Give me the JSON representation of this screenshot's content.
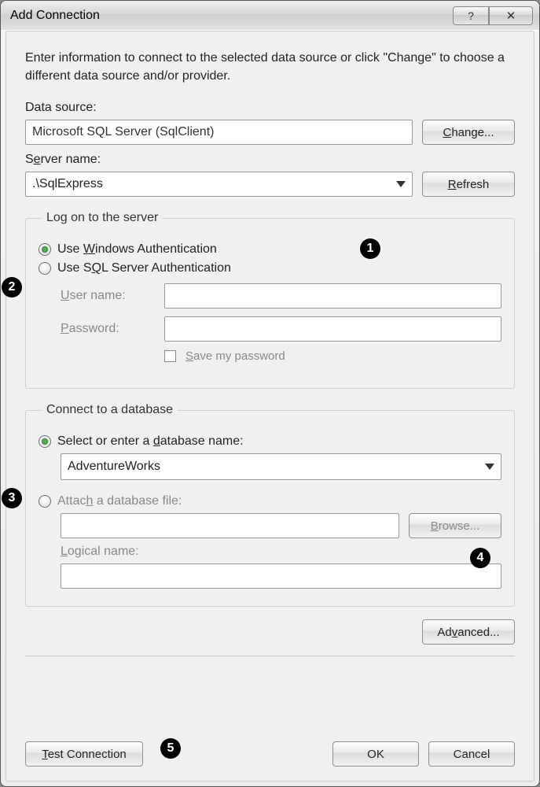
{
  "window": {
    "title": "Add Connection"
  },
  "instructions": "Enter information to connect to the selected data source or click \"Change\" to choose a different data source and/or provider.",
  "dataSource": {
    "label": "Data source:",
    "value": "Microsoft SQL Server (SqlClient)",
    "changeBtn": "Change..."
  },
  "serverName": {
    "label": "Server name:",
    "value": ".\\SqlExpress",
    "refreshBtn": "Refresh"
  },
  "logon": {
    "legend": "Log on to the server",
    "radioWindows": "Use Windows Authentication",
    "radioSql": "Use SQL Server Authentication",
    "userLabel": "User name:",
    "passLabel": "Password:",
    "saveCheck": "Save my password"
  },
  "database": {
    "legend": "Connect to a database",
    "radioSelect": "Select or enter a database name:",
    "comboValue": "AdventureWorks",
    "radioAttach": "Attach a database file:",
    "browseBtn": "Browse...",
    "logicalLabel": "Logical name:"
  },
  "advancedBtn": "Advanced...",
  "bottom": {
    "testBtn": "Test Connection",
    "okBtn": "OK",
    "cancelBtn": "Cancel"
  },
  "callouts": {
    "c1": "1",
    "c2": "2",
    "c3": "3",
    "c4": "4",
    "c5": "5"
  }
}
